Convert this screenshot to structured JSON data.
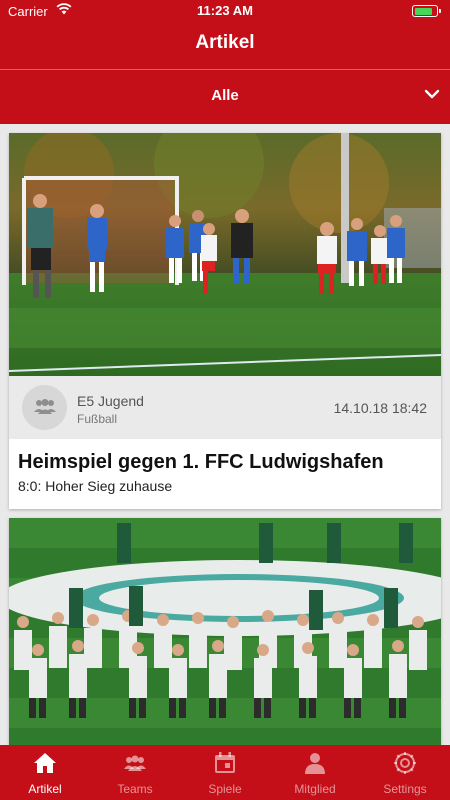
{
  "status": {
    "carrier": "Carrier",
    "time": "11:23 AM",
    "battery_level": 0.85
  },
  "header": {
    "title": "Artikel"
  },
  "filter": {
    "selected": "Alle"
  },
  "articles": [
    {
      "team": "E5 Jugend",
      "sport": "Fußball",
      "datetime": "14.10.18 18:42",
      "title": "Heimspiel gegen 1. FFC Ludwigshafen",
      "subtitle": "8:0: Hoher Sieg zuhause"
    }
  ],
  "tabs": [
    {
      "label": "Artikel",
      "icon": "home-icon",
      "active": true
    },
    {
      "label": "Teams",
      "icon": "teams-icon",
      "active": false
    },
    {
      "label": "Spiele",
      "icon": "calendar-icon",
      "active": false
    },
    {
      "label": "Mitglied",
      "icon": "person-icon",
      "active": false
    },
    {
      "label": "Settings",
      "icon": "settings-icon",
      "active": false
    }
  ],
  "colors": {
    "brand": "#c40e18",
    "card_meta_bg": "#eaeaea",
    "battery": "#47d65a"
  }
}
